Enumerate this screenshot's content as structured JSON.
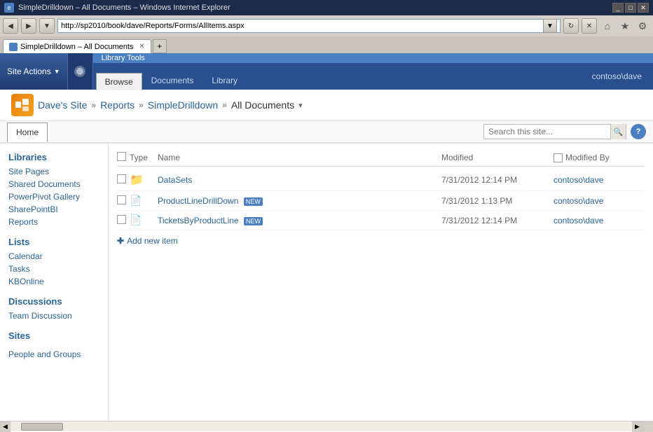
{
  "browser": {
    "title": "SimpleDrilldown – All Documents – Windows Internet Explorer",
    "address": "http://sp2010/book/dave/Reports/Forms/AllItems.aspx",
    "tab_label": "SimpleDrilldown – All Documents",
    "favicon": "IE"
  },
  "ribbon": {
    "site_actions_label": "Site Actions",
    "context_label": "Library Tools",
    "tabs": [
      {
        "id": "browse",
        "label": "Browse",
        "active": true
      },
      {
        "id": "documents",
        "label": "Documents",
        "active": false
      },
      {
        "id": "library",
        "label": "Library",
        "active": false
      }
    ],
    "user": "contoso\\dave"
  },
  "breadcrumb": {
    "site": "Dave's Site",
    "sep1": "»",
    "section": "Reports",
    "sep2": "»",
    "subsection": "SimpleDrilldown",
    "sep3": "»",
    "page": "All Documents",
    "dropdown": "▾"
  },
  "nav": {
    "home_label": "Home",
    "search_placeholder": "Search this site...",
    "search_btn": "🔍",
    "help_btn": "?"
  },
  "sidebar": {
    "libraries_title": "Libraries",
    "libraries_items": [
      {
        "label": "Site Pages"
      },
      {
        "label": "Shared Documents"
      },
      {
        "label": "PowerPivot Gallery"
      },
      {
        "label": "SharePointBI"
      },
      {
        "label": "Reports"
      }
    ],
    "lists_title": "Lists",
    "lists_items": [
      {
        "label": "Calendar"
      },
      {
        "label": "Tasks"
      },
      {
        "label": "KBOnline"
      }
    ],
    "discussions_title": "Discussions",
    "discussions_items": [
      {
        "label": "Team Discussion"
      }
    ],
    "sites_title": "Sites",
    "sites_items": [],
    "people_label": "People and Groups"
  },
  "list": {
    "col_type": "Type",
    "col_name": "Name",
    "col_modified": "Modified",
    "col_modified_by": "Modified By",
    "rows": [
      {
        "id": "datasets",
        "type": "folder",
        "icon": "📁",
        "name": "DataSets",
        "modified": "7/31/2012 12:14 PM",
        "modified_by": "contoso\\dave",
        "is_new": false
      },
      {
        "id": "productline",
        "type": "doc",
        "icon": "📄",
        "name": "ProductLineDrillDown",
        "modified": "7/31/2012 1:13 PM",
        "modified_by": "contoso\\dave",
        "is_new": true
      },
      {
        "id": "tickets",
        "type": "doc",
        "icon": "📄",
        "name": "TicketsByProductLine",
        "modified": "7/31/2012 12:14 PM",
        "modified_by": "contoso\\dave",
        "is_new": true
      }
    ],
    "add_label": "Add new item",
    "new_badge": "NEW"
  },
  "colors": {
    "accent_blue": "#2a6496",
    "ribbon_blue": "#2a4f8f",
    "context_blue": "#4a7fc1",
    "folder_yellow": "#d4a020"
  }
}
